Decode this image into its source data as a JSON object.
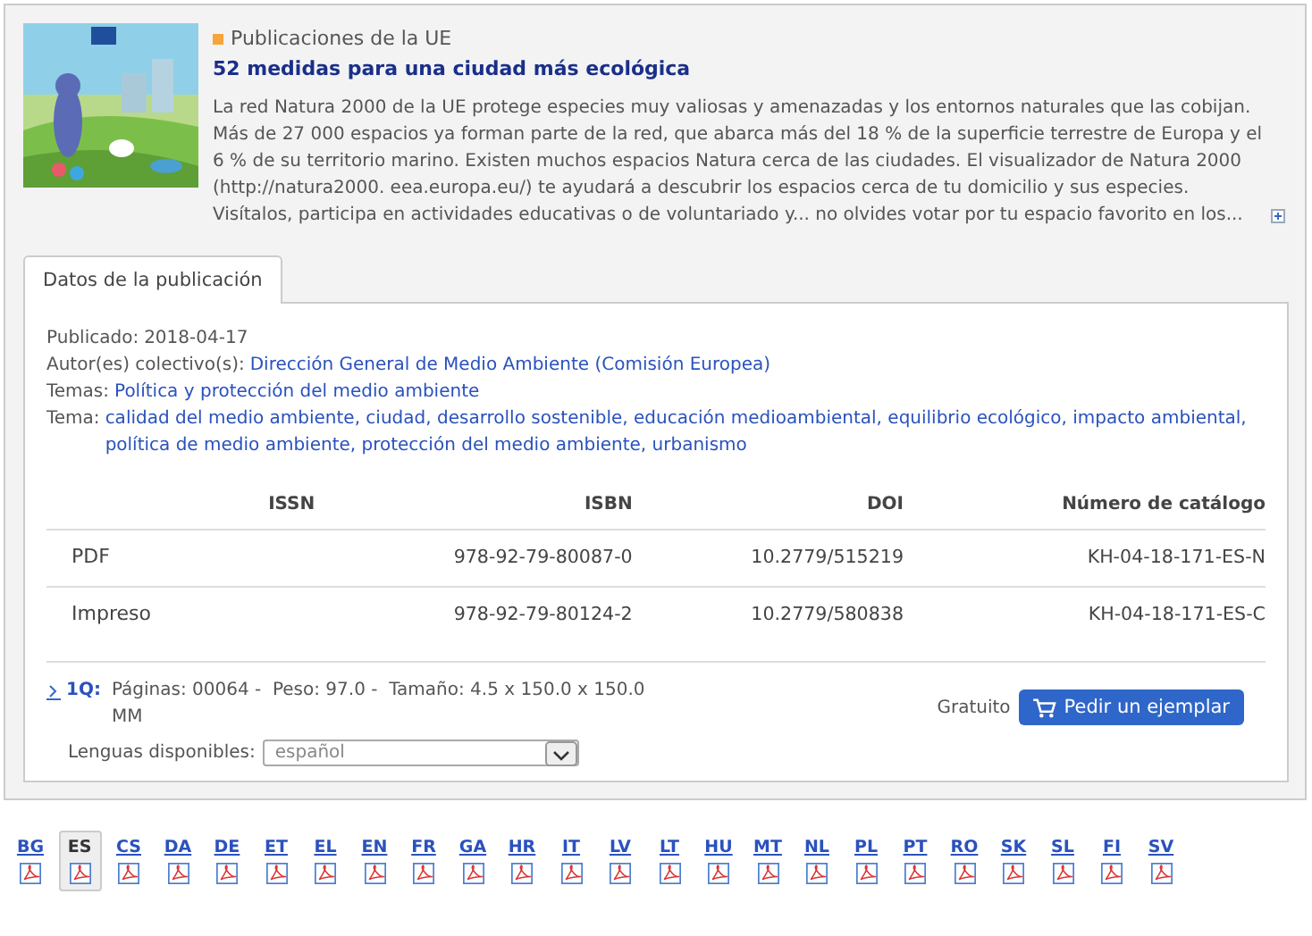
{
  "publication": {
    "source": "Publicaciones de la UE",
    "title": "52 medidas para una ciudad más ecológica",
    "description": "La red Natura 2000 de la UE protege especies muy valiosas y amenazadas y los entornos naturales que las cobijan. Más de 27 000 espacios ya forman parte de la red, que abarca más del 18 % de la superficie terrestre de Europa y el 6 % de su territorio marino. Existen muchos espacios Natura cerca de las ciudades. El visualizador de Natura 2000 (http://natura2000. eea.europa.eu/) te ayudará a descubrir los espacios cerca de tu domicilio y sus especies. Visítalos, participa en actividades educativas o de voluntariado y... no olvides votar por tu espacio favorito en los..."
  },
  "tabs": [
    {
      "label": "Datos de la publicación",
      "selected": true
    }
  ],
  "details": [
    {
      "label": "Publicado:",
      "value": "2018-04-17",
      "kind": "plain"
    },
    {
      "label": "Autor(es) colectivo(s):",
      "value": "Dirección General de Medio Ambiente (Comisión Europea)",
      "kind": "link"
    },
    {
      "label": "Temas:",
      "value": "Política y protección del medio ambiente",
      "kind": "link"
    },
    {
      "label": "Tema:",
      "value": "calidad del medio ambiente, ciudad, desarrollo sostenible, educación medioambiental, equilibrio ecológico, impacto ambiental, política de medio ambiente, protección del medio ambiente, urbanismo",
      "kind": "link"
    }
  ],
  "table": {
    "columns": [
      "ISSN",
      "ISBN",
      "DOI",
      "Número de catálogo"
    ],
    "rows": [
      {
        "format": "PDF",
        "isbn": "978-92-79-80087-0",
        "doi": "10.2779/515219",
        "catalog": "KH-04-18-171-ES-N"
      },
      {
        "format": "Impreso",
        "isbn": "978-92-79-80124-2",
        "doi": "10.2779/580838",
        "catalog": "KH-04-18-171-ES-C"
      }
    ]
  },
  "order": {
    "code": "1Q:",
    "info": "Páginas: 00064 -  Peso: 97.0 -  Tamaño: 4.5 x 150.0 x 150.0 MM",
    "price": "Gratuito",
    "button": "Pedir un ejemplar",
    "languages_label": "Lenguas disponibles:",
    "language_value": "español"
  },
  "languages": [
    {
      "code": "BG",
      "selected": false
    },
    {
      "code": "ES",
      "selected": true
    },
    {
      "code": "CS",
      "selected": false
    },
    {
      "code": "DA",
      "selected": false
    },
    {
      "code": "DE",
      "selected": false
    },
    {
      "code": "ET",
      "selected": false
    },
    {
      "code": "EL",
      "selected": false
    },
    {
      "code": "EN",
      "selected": false
    },
    {
      "code": "FR",
      "selected": false
    },
    {
      "code": "GA",
      "selected": false
    },
    {
      "code": "HR",
      "selected": false
    },
    {
      "code": "IT",
      "selected": false
    },
    {
      "code": "LV",
      "selected": false
    },
    {
      "code": "LT",
      "selected": false
    },
    {
      "code": "HU",
      "selected": false
    },
    {
      "code": "MT",
      "selected": false
    },
    {
      "code": "NL",
      "selected": false
    },
    {
      "code": "PL",
      "selected": false
    },
    {
      "code": "PT",
      "selected": false
    },
    {
      "code": "RO",
      "selected": false
    },
    {
      "code": "SK",
      "selected": false
    },
    {
      "code": "SL",
      "selected": false
    },
    {
      "code": "FI",
      "selected": false
    },
    {
      "code": "SV",
      "selected": false
    }
  ]
}
